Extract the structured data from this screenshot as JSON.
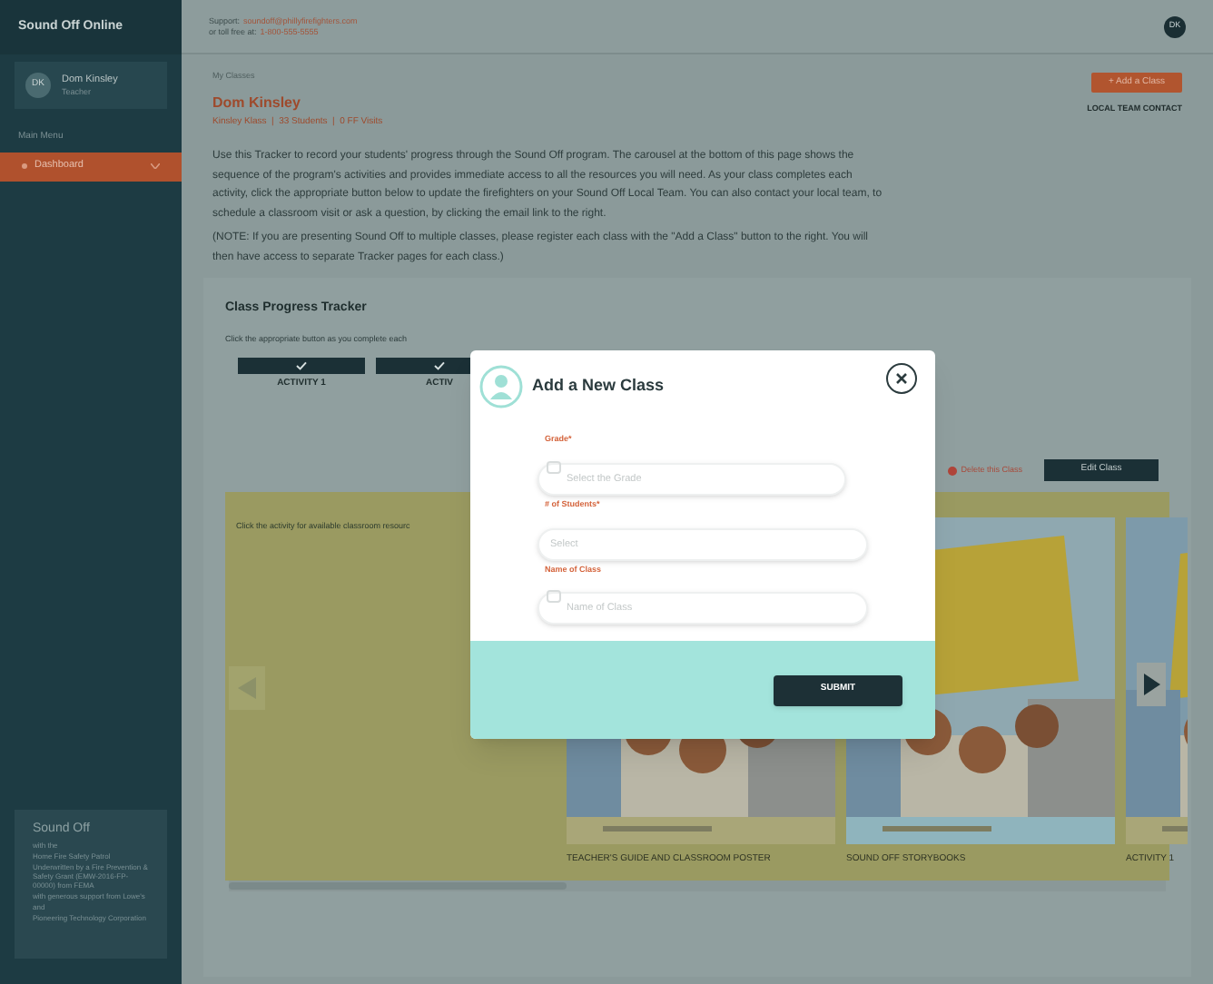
{
  "sidebar": {
    "brand": "Sound Off Online",
    "user": {
      "initials": "DK",
      "name": "Dom Kinsley",
      "role": "Teacher"
    },
    "menu_heading": "Main Menu",
    "items": [
      {
        "label": "Dashboard",
        "selected": true
      }
    ],
    "sponsor": {
      "title": "Sound Off",
      "lines": [
        "with the",
        "Home Fire Safety Patrol",
        "Underwritten by a Fire Prevention & Safety Grant (EMW-2016-FP-00000) from FEMA",
        "with generous support from Lowe's",
        "and",
        "Pioneering Technology Corporation"
      ]
    }
  },
  "header": {
    "support_label": "Support:",
    "support_email": "soundoff@phillyfirefighters.com",
    "phone_label": "or toll free at:",
    "phone": "1-800-555-5555",
    "avatar": "DK"
  },
  "page": {
    "breadcrumb": "My Classes",
    "teacher": "Dom Kinsley",
    "meta": "Kinsley Klass  |  33 Students  |  0 FF Visits",
    "intro": "Use this Tracker to record your students' progress through the Sound Off program. The carousel at the bottom of this page shows the sequence of the program's activities and provides immediate access to all the resources you will need. As your class completes each activity, click the appropriate button below to update the firefighters on your Sound Off Local Team. You can also contact your local team, to schedule a classroom visit or ask a question, by clicking the email link to the right.",
    "note": "(NOTE: If you are presenting Sound Off to multiple classes, please register each class with the \"Add a Class\" button to the right. You will then have access to separate Tracker pages for each class.)",
    "add_button": "+ Add a Class",
    "contact_link": "LOCAL TEAM CONTACT"
  },
  "tracker": {
    "title": "Class Progress Tracker",
    "hint": "Click the appropriate button as you complete each",
    "activities": [
      {
        "label": "ACTIVITY 1",
        "checked": true
      },
      {
        "label": "ACTIV",
        "checked": true
      }
    ],
    "delete_link": "Delete this Class",
    "edit_button": "Edit Class",
    "carousel": {
      "hint": "Click the activity for available classroom resourc",
      "cards": [
        {
          "kind": "picture",
          "caption": "TEACHER'S GUIDE AND CLASSROOM POSTER"
        },
        {
          "kind": "picture",
          "caption": "SOUND OFF STORYBOOKS"
        },
        {
          "kind": "picture",
          "caption": "ACTIVITY 1"
        }
      ]
    }
  },
  "dialog": {
    "title": "Add a New Class",
    "fields": [
      {
        "label": "Grade*",
        "placeholder": "Select the Grade",
        "kind": "select"
      },
      {
        "label": "# of Students*",
        "placeholder": "Select",
        "kind": "plain"
      },
      {
        "label": "Name of Class",
        "placeholder": "Name of Class",
        "kind": "text"
      }
    ],
    "submit": "SUBMIT"
  }
}
